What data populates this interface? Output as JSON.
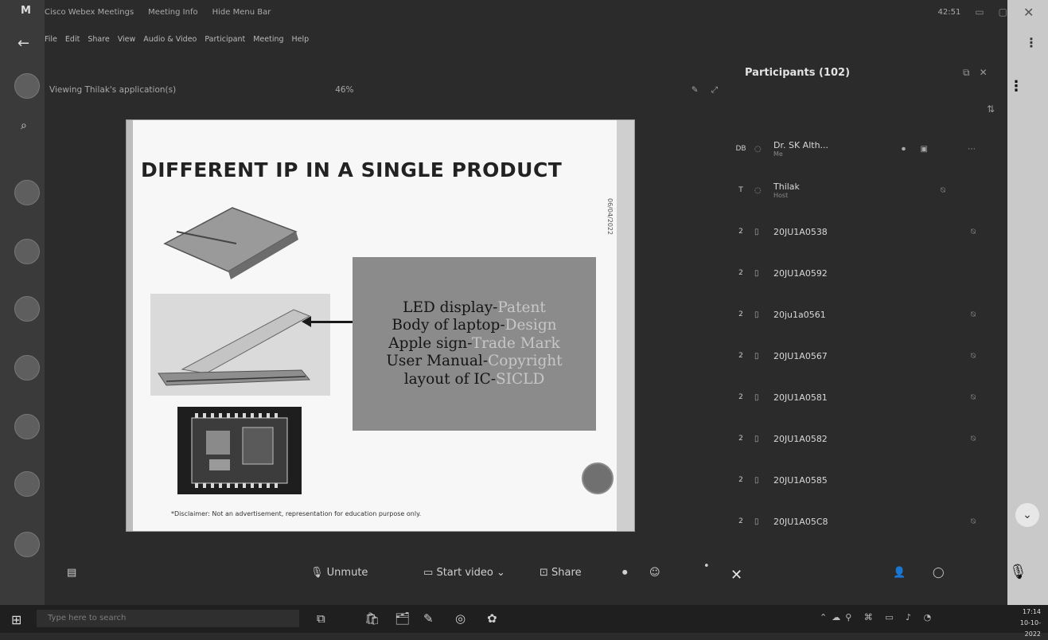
{
  "window": {
    "app_title": "Cisco Webex Meetings",
    "meeting_info": "Meeting Info",
    "hide_menu": "Hide Menu Bar",
    "counter": "42:51"
  },
  "browser": {
    "profile_letter": "M"
  },
  "menu": [
    "File",
    "Edit",
    "Share",
    "View",
    "Audio & Video",
    "Participant",
    "Meeting",
    "Help"
  ],
  "sharing": {
    "label": "Viewing Thilak's application(s)",
    "zoom": "46%"
  },
  "slide": {
    "title": "DIFFERENT IP IN A SINGLE PRODUCT",
    "date": "06/04/2022",
    "ip_items": [
      {
        "part": "LED display-",
        "kind": "Patent"
      },
      {
        "part": "Body of laptop-",
        "kind": "Design"
      },
      {
        "part": "Apple sign-",
        "kind": "Trade Mark"
      },
      {
        "part": "User Manual-",
        "kind": "Copyright"
      },
      {
        "part": "layout of IC-",
        "kind": "SICLD"
      }
    ],
    "disclaimer": "*Disclaimer: Not an advertisement, representation for education purpose only."
  },
  "participants": {
    "title": "Participants (102)",
    "list": [
      {
        "initials": "DB",
        "name": "Dr. SK Alth...",
        "role": "Me"
      },
      {
        "initials": "T",
        "name": "Thilak",
        "role": "Host"
      },
      {
        "initials": "2",
        "name": "20JU1A0538"
      },
      {
        "initials": "2",
        "name": "20JU1A0592"
      },
      {
        "initials": "2",
        "name": "20ju1a0561"
      },
      {
        "initials": "2",
        "name": "20JU1A0567"
      },
      {
        "initials": "2",
        "name": "20JU1A0581"
      },
      {
        "initials": "2",
        "name": "20JU1A0582"
      },
      {
        "initials": "2",
        "name": "20JU1A0585"
      },
      {
        "initials": "2",
        "name": "20JU1A05C8"
      }
    ]
  },
  "controls": {
    "unmute": "Unmute",
    "start_video": "Start video",
    "share": "Share"
  },
  "taskbar": {
    "search_placeholder": "Type here to search",
    "time": "17:14",
    "date": "10-10-2022"
  }
}
